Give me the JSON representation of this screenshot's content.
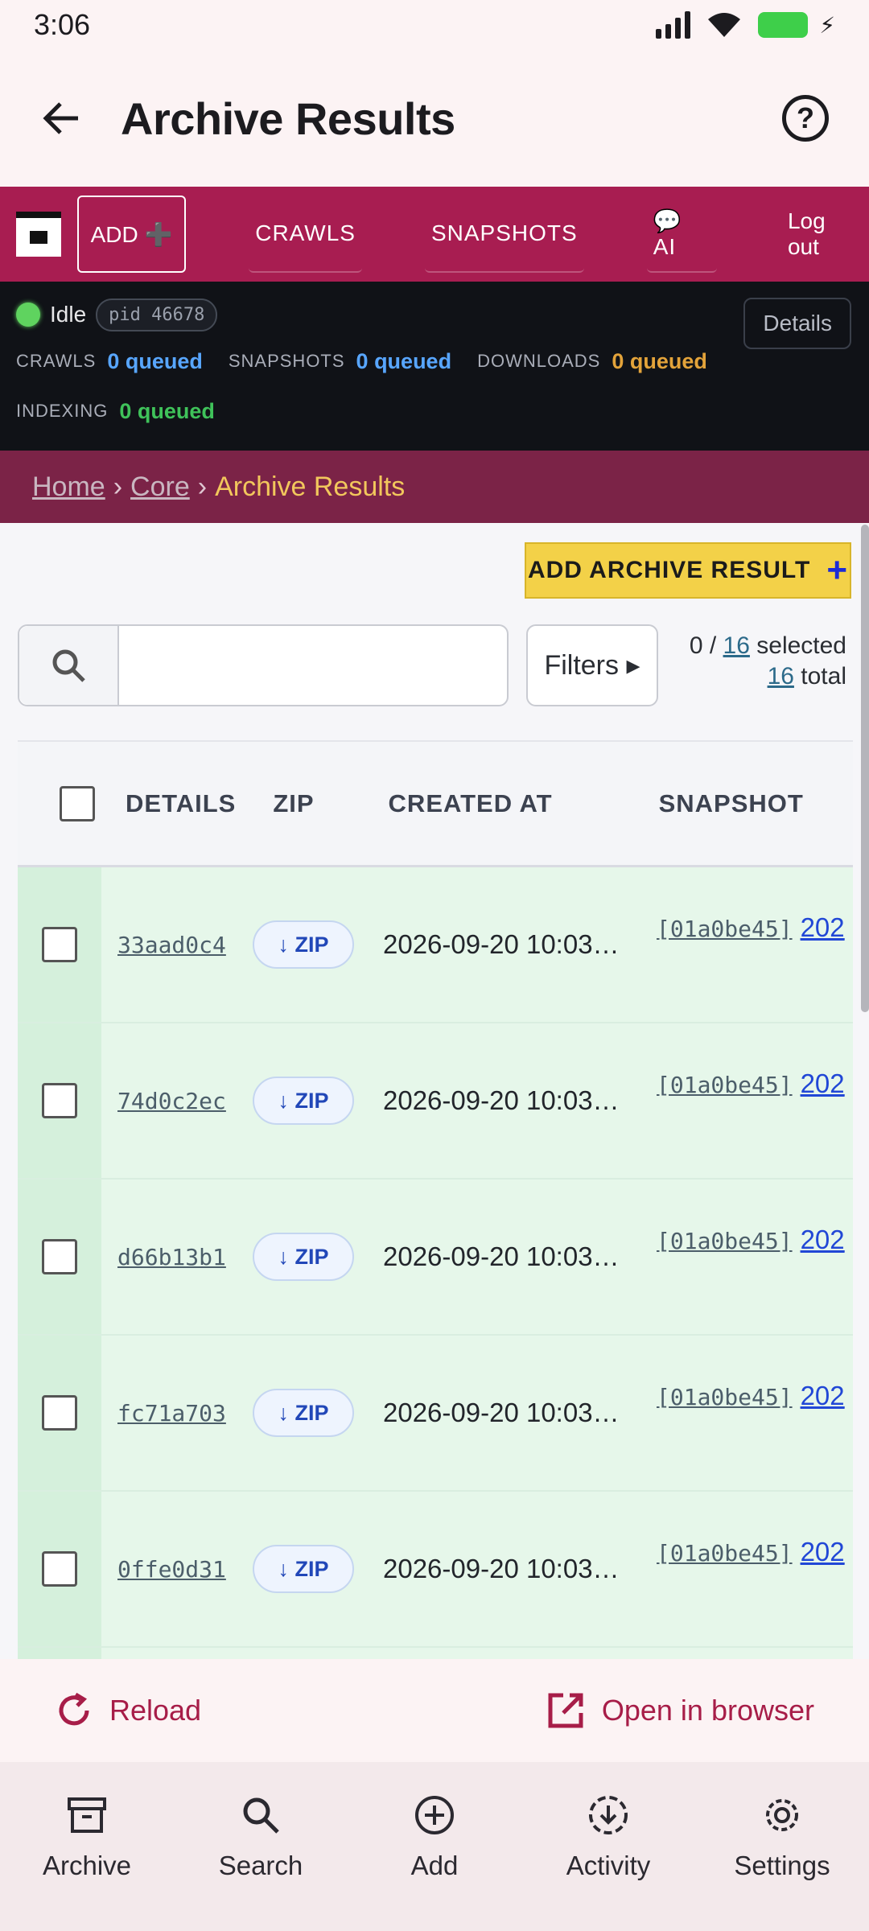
{
  "status_bar": {
    "time": "3:06"
  },
  "app_bar": {
    "title": "Archive Results"
  },
  "nav": {
    "add_label": "ADD ➕",
    "crawls": "CRAWLS",
    "snapshots": "SNAPSHOTS",
    "ai": "💬 AI",
    "logout": "Log out"
  },
  "status_panel": {
    "state": "Idle",
    "pid": "pid 46678",
    "details_label": "Details",
    "crawls_label": "CRAWLS",
    "crawls_value": "0 queued",
    "snapshots_label": "SNAPSHOTS",
    "snapshots_value": "0 queued",
    "downloads_label": "DOWNLOADS",
    "downloads_value": "0 queued",
    "indexing_label": "INDEXING",
    "indexing_value": "0 queued"
  },
  "breadcrumb": {
    "home": "Home",
    "core": "Core",
    "current": "Archive Results",
    "sep": "›"
  },
  "toolbar": {
    "add_result": "ADD ARCHIVE RESULT",
    "search_value": "",
    "filters": "Filters ▸",
    "selected_prefix": "0 / ",
    "selected_count": "16",
    "selected_suffix": " selected",
    "total_count": "16",
    "total_suffix": " total"
  },
  "table": {
    "headers": {
      "details": "DETAILS",
      "zip": "ZIP",
      "created_at": "CREATED AT",
      "snapshot": "SNAPSHOT"
    },
    "zip_label": "↓ ZIP",
    "rows": [
      {
        "id": "33aad0c4",
        "created": "2026-09-20 10:03…",
        "snapshot": "[01a0be45]",
        "snapshot_title": "202"
      },
      {
        "id": "74d0c2ec",
        "created": "2026-09-20 10:03…",
        "snapshot": "[01a0be45]",
        "snapshot_title": "202"
      },
      {
        "id": "d66b13b1",
        "created": "2026-09-20 10:03…",
        "snapshot": "[01a0be45]",
        "snapshot_title": "202"
      },
      {
        "id": "fc71a703",
        "created": "2026-09-20 10:03…",
        "snapshot": "[01a0be45]",
        "snapshot_title": "202"
      },
      {
        "id": "0ffe0d31",
        "created": "2026-09-20 10:03…",
        "snapshot": "[01a0be45]",
        "snapshot_title": "202"
      }
    ]
  },
  "actions": {
    "reload": "Reload",
    "open_browser": "Open in browser"
  },
  "bottom_nav": [
    {
      "label": "Archive",
      "icon": "archive-icon"
    },
    {
      "label": "Search",
      "icon": "search-icon"
    },
    {
      "label": "Add",
      "icon": "add-circle-icon"
    },
    {
      "label": "Activity",
      "icon": "download-circle-icon"
    },
    {
      "label": "Settings",
      "icon": "gear-icon"
    }
  ],
  "colors": {
    "brand": "#a81d51",
    "accent": "#f3d148",
    "action": "#a71d48"
  }
}
